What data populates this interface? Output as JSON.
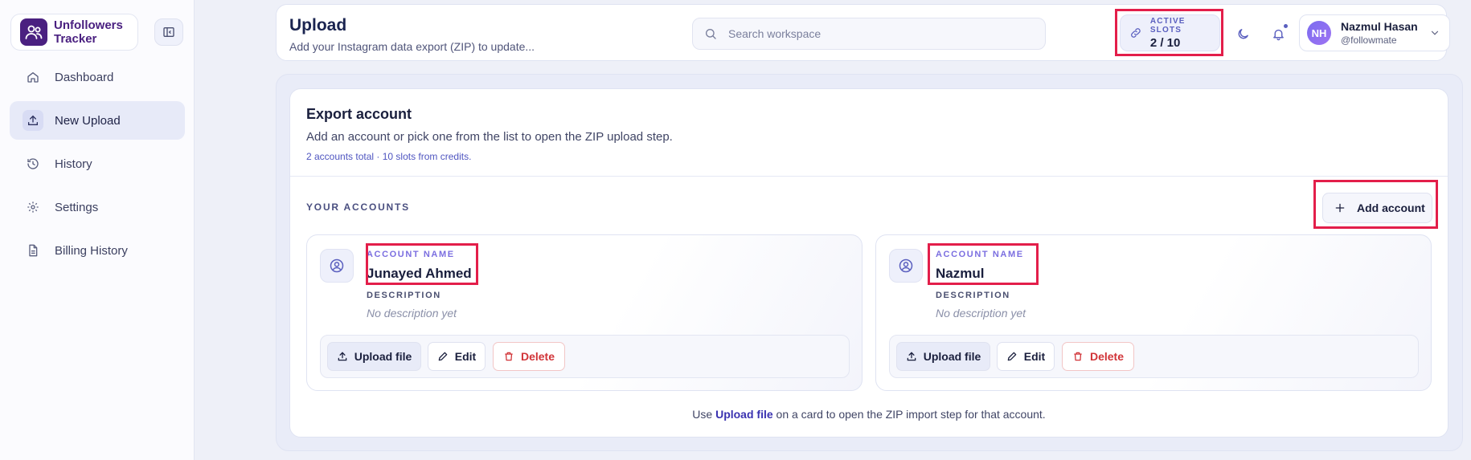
{
  "brand": {
    "name": "Unfollowers Tracker"
  },
  "sidebar": {
    "items": [
      {
        "label": "Dashboard",
        "icon": "home-icon",
        "active": false
      },
      {
        "label": "New Upload",
        "icon": "upload-icon",
        "active": true
      },
      {
        "label": "History",
        "icon": "history-icon",
        "active": false
      },
      {
        "label": "Settings",
        "icon": "gear-icon",
        "active": false
      },
      {
        "label": "Billing History",
        "icon": "document-icon",
        "active": false
      }
    ]
  },
  "header": {
    "title": "Upload",
    "subtitle": "Add your Instagram data export (ZIP) to update...",
    "search_placeholder": "Search workspace",
    "slots_label": "ACTIVE SLOTS",
    "slots_value": "2 / 10",
    "user": {
      "initials": "NH",
      "name": "Nazmul Hasan",
      "handle": "@followmate"
    }
  },
  "main": {
    "title": "Export account",
    "description": "Add an account or pick one from the list to open the ZIP upload step.",
    "meta": "2 accounts total · 10 slots from credits.",
    "section_label": "YOUR ACCOUNTS",
    "add_button": "Add account",
    "cards": [
      {
        "name_label": "ACCOUNT NAME",
        "name": "Junayed Ahmed",
        "desc_label": "DESCRIPTION",
        "desc": "No description yet",
        "upload": "Upload file",
        "edit": "Edit",
        "delete": "Delete"
      },
      {
        "name_label": "ACCOUNT NAME",
        "name": "Nazmul",
        "desc_label": "DESCRIPTION",
        "desc": "No description yet",
        "upload": "Upload file",
        "edit": "Edit",
        "delete": "Delete"
      }
    ],
    "footer": {
      "pre": "Use",
      "link": "Upload file",
      "post": "on a card to open the ZIP import step for that account."
    }
  },
  "colors": {
    "accent": "#4a2080",
    "highlight": "#e31e4a",
    "danger": "#d13438"
  }
}
